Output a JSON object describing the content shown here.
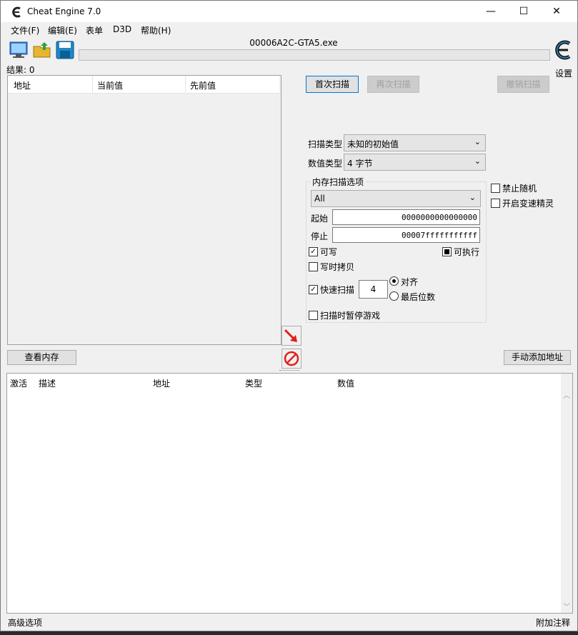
{
  "window": {
    "title": "Cheat Engine 7.0",
    "controls": {
      "minimize": "—",
      "maximize": "☐",
      "close": "✕"
    }
  },
  "menu": [
    "文件(F)",
    "编辑(E)",
    "表单",
    "D3D",
    "帮助(H)"
  ],
  "toolbar": {
    "process_name": "00006A2C-GTA5.exe",
    "settings_label": "设置"
  },
  "results": {
    "count_label": "结果: 0",
    "columns": [
      "地址",
      "当前值",
      "先前值"
    ]
  },
  "scan": {
    "first_scan": "首次扫描",
    "next_scan": "再次扫描",
    "undo_scan": "撤销扫描",
    "scan_type_label": "扫描类型",
    "scan_type_value": "未知的初始值",
    "value_type_label": "数值类型",
    "value_type_value": "4 字节",
    "memory_options": {
      "title": "内存扫描选项",
      "region": "All",
      "start_label": "起始",
      "start_value": "0000000000000000",
      "stop_label": "停止",
      "stop_value": "00007fffffffffff",
      "writable": "可写",
      "executable": "可执行",
      "copy_on_write": "写时拷贝",
      "fast_scan": "快速扫描",
      "fast_scan_value": "4",
      "align": "对齐",
      "last_digits": "最后位数",
      "pause_game": "扫描时暂停游戏"
    },
    "disable_random": "禁止随机",
    "speedhack": "开启变速精灵"
  },
  "buttons": {
    "view_memory": "查看内存",
    "add_address": "手动添加地址"
  },
  "address_table": {
    "columns": [
      "激活",
      "描述",
      "地址",
      "类型",
      "数值"
    ]
  },
  "status": {
    "advanced": "高级选项",
    "comments": "附加注释"
  },
  "icons": {
    "app": "cheat-engine-logo-icon",
    "process": "computer-process-icon",
    "open": "open-folder-icon",
    "save": "save-disk-icon",
    "arrow": "red-arrow-icon",
    "stop": "stop-icon"
  },
  "colors": {
    "accent": "#0078d7",
    "arrow": "#e0201a"
  }
}
